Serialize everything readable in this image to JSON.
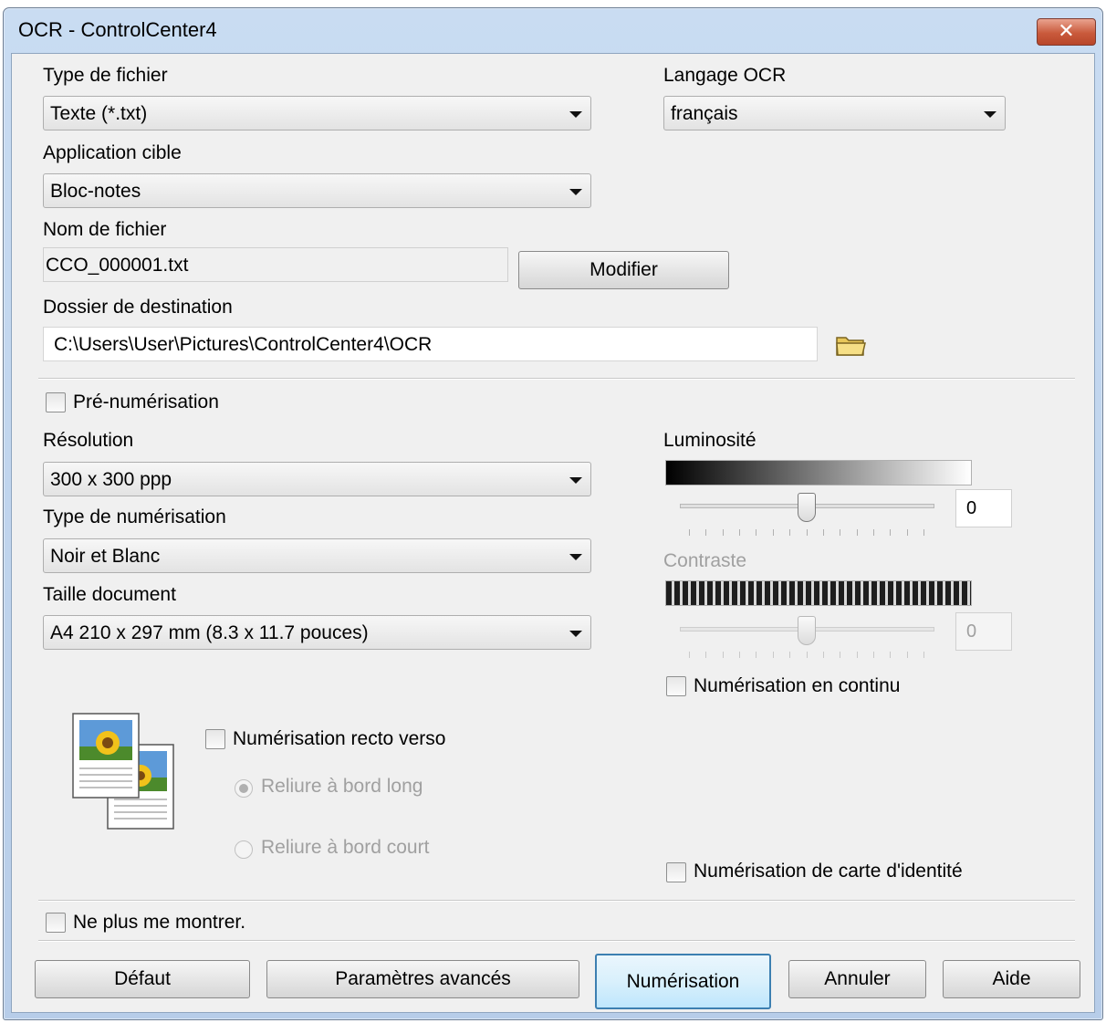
{
  "window": {
    "title": "OCR - ControlCenter4",
    "close_glyph": "✕"
  },
  "file_type": {
    "label": "Type de fichier",
    "value": "Texte (*.txt)"
  },
  "ocr_language": {
    "label": "Langage OCR",
    "value": "français"
  },
  "target_app": {
    "label": "Application cible",
    "value": "Bloc-notes"
  },
  "file_name": {
    "label": "Nom de fichier",
    "value": "CCO_000001.txt",
    "modify_button": "Modifier"
  },
  "destination": {
    "label": "Dossier de destination",
    "value": "C:\\Users\\User\\Pictures\\ControlCenter4\\OCR",
    "icon": "folder-icon"
  },
  "prescan": {
    "label": "Pré-numérisation",
    "checked": false
  },
  "resolution": {
    "label": "Résolution",
    "value": "300 x 300 ppp"
  },
  "scan_type": {
    "label": "Type de numérisation",
    "value": "Noir et Blanc"
  },
  "doc_size": {
    "label": "Taille document",
    "value": "A4 210 x 297 mm (8.3 x 11.7 pouces)"
  },
  "brightness": {
    "label": "Luminosité",
    "value": "0",
    "slider_level": 0.5,
    "enabled": true
  },
  "contrast": {
    "label": "Contraste",
    "value": "0",
    "slider_level": 0.5,
    "enabled": false
  },
  "continuous_scan": {
    "label": "Numérisation en continu",
    "checked": false
  },
  "duplex": {
    "label": "Numérisation recto verso",
    "checked": false,
    "long_edge": "Reliure à bord long",
    "short_edge": "Reliure à bord court",
    "selected": "long_edge"
  },
  "id_card": {
    "label": "Numérisation de carte d'identité",
    "checked": false
  },
  "dont_show": {
    "label": "Ne plus me montrer.",
    "checked": false
  },
  "buttons": {
    "default": "Défaut",
    "advanced": "Paramètres avancés",
    "scan": "Numérisation",
    "cancel": "Annuler",
    "help": "Aide"
  },
  "colors": {
    "titlebar": "#c9dcf2",
    "dialog_bg": "#f0f0f0",
    "close_red": "#c95a3c",
    "default_btn_border": "#3c7fb1"
  }
}
